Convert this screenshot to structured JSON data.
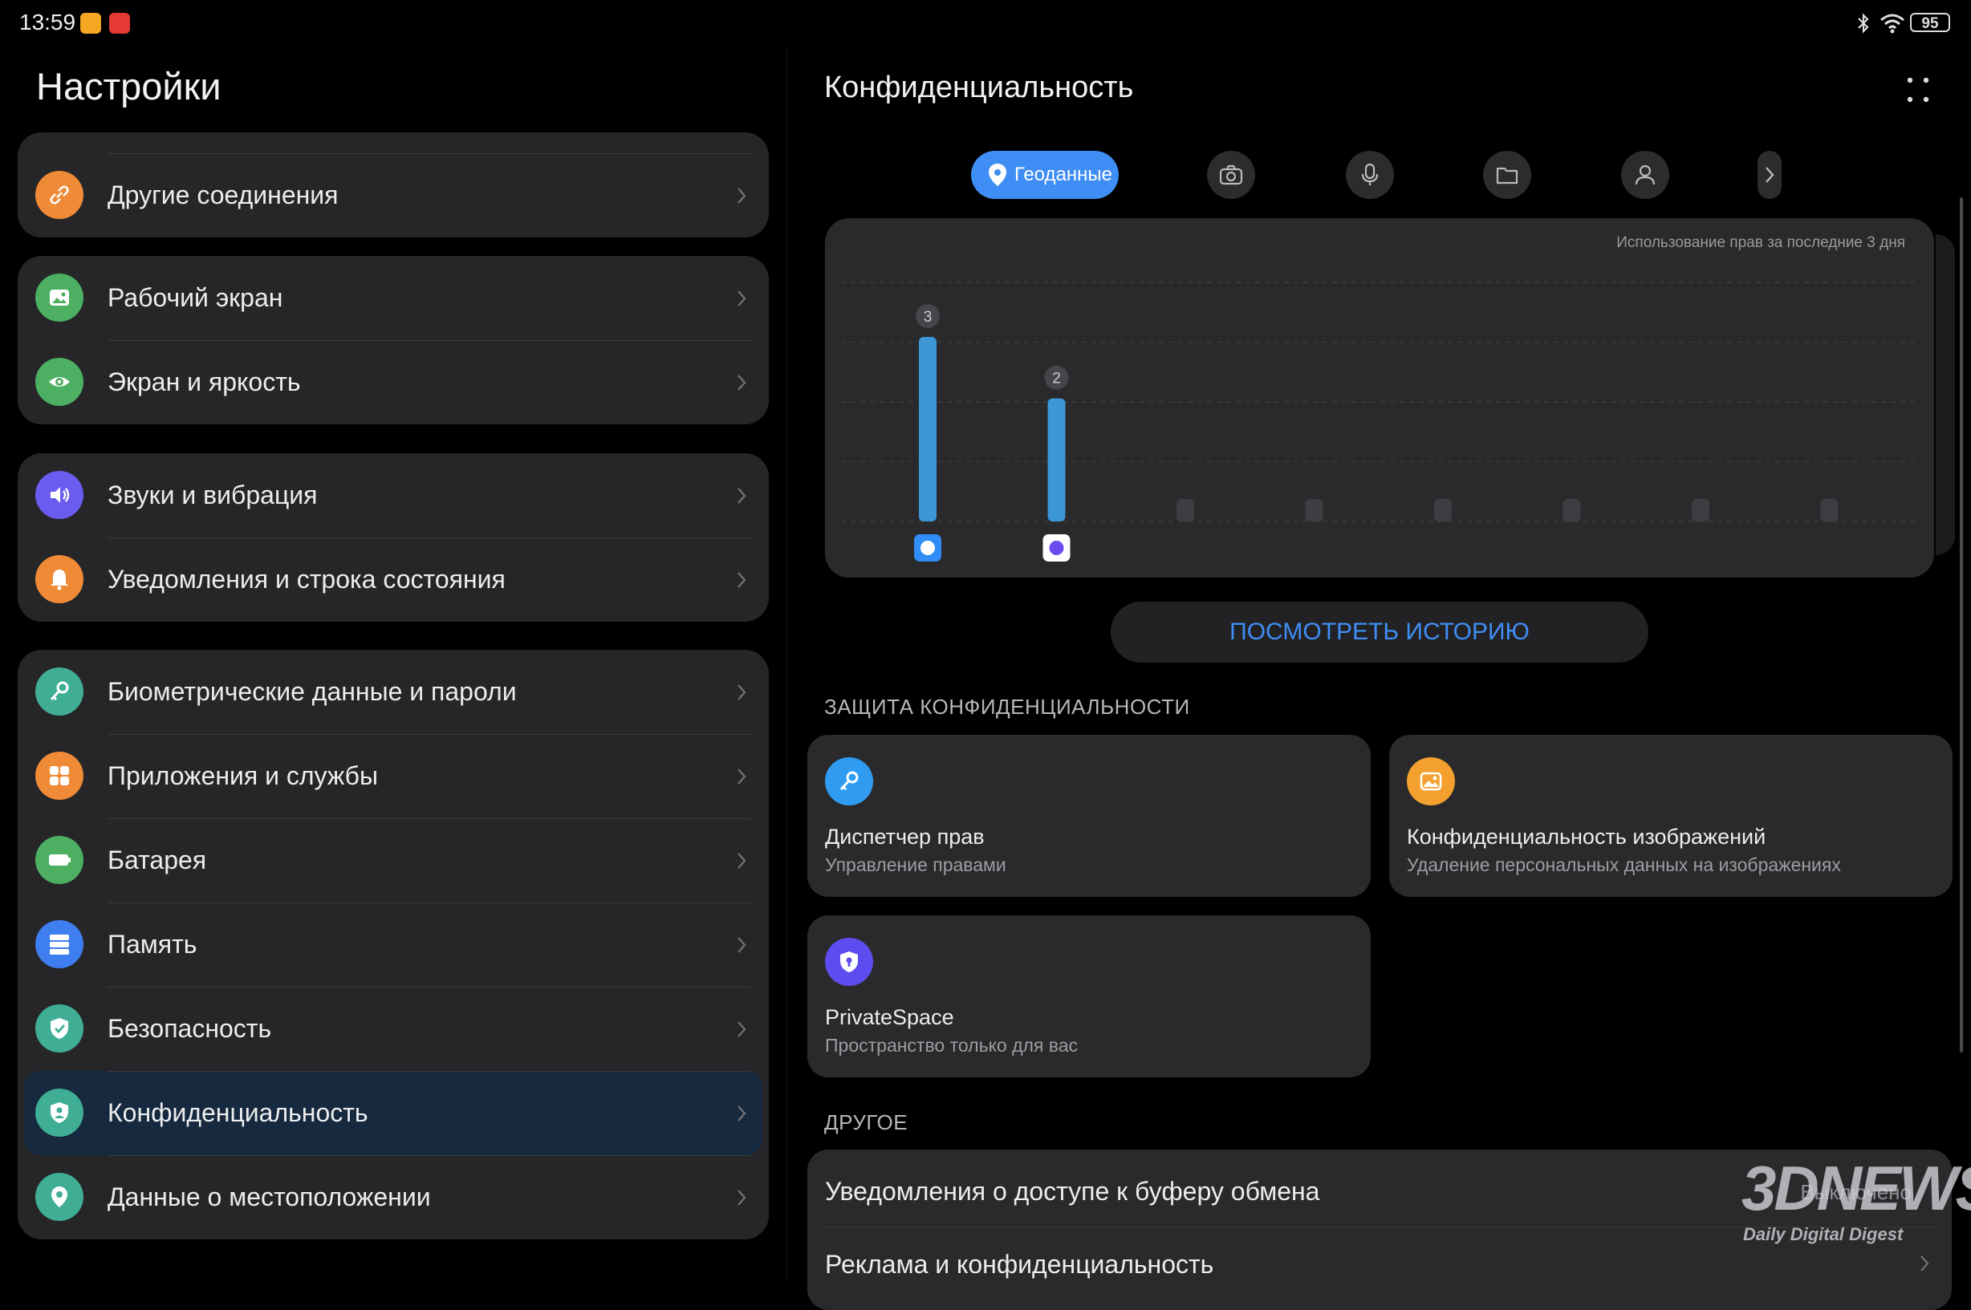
{
  "status_bar": {
    "time": "13:59",
    "battery": "95"
  },
  "settings": {
    "title": "Настройки",
    "groups": [
      {
        "items": [
          {
            "label": "Другие соединения",
            "icon": "link-icon",
            "color": "#ef8a36"
          }
        ]
      },
      {
        "items": [
          {
            "label": "Рабочий экран",
            "icon": "image-icon",
            "color": "#4caf62"
          },
          {
            "label": "Экран и яркость",
            "icon": "eye-icon",
            "color": "#4caf62"
          }
        ]
      },
      {
        "items": [
          {
            "label": "Звуки и вибрация",
            "icon": "speaker-icon",
            "color": "#6b5cf0"
          },
          {
            "label": "Уведомления и строка состояния",
            "icon": "bell-icon",
            "color": "#ef8a36"
          }
        ]
      },
      {
        "items": [
          {
            "label": "Биометрические данные и пароли",
            "icon": "key-icon",
            "color": "#3fae94"
          },
          {
            "label": "Приложения и службы",
            "icon": "apps-grid-icon",
            "color": "#ef8a36"
          },
          {
            "label": "Батарея",
            "icon": "battery-icon",
            "color": "#4caf62"
          },
          {
            "label": "Память",
            "icon": "storage-icon",
            "color": "#3f7ef0"
          },
          {
            "label": "Безопасность",
            "icon": "shield-check-icon",
            "color": "#3fae94"
          },
          {
            "label": "Конфиденциальность",
            "icon": "privacy-shield-icon",
            "color": "#3fae94",
            "selected": true
          },
          {
            "label": "Данные о местоположении",
            "icon": "location-pin-icon",
            "color": "#3fae94"
          }
        ]
      }
    ]
  },
  "privacy": {
    "title": "Конфиденциальность",
    "tabs": [
      {
        "label": "Геоданные",
        "icon": "location-pin-icon",
        "active": true
      },
      {
        "label": "",
        "icon": "camera-icon"
      },
      {
        "label": "",
        "icon": "microphone-icon"
      },
      {
        "label": "",
        "icon": "folder-icon"
      },
      {
        "label": "",
        "icon": "contacts-icon"
      },
      {
        "label": "",
        "icon": "chevron-right-icon"
      }
    ],
    "chart_caption": "Использование прав за последние 3 дня",
    "history_button": "ПОСМОТРЕТЬ ИСТОРИЮ",
    "protection_header": "ЗАЩИТА КОНФИДЕНЦИАЛЬНОСТИ",
    "cards": [
      {
        "title": "Диспетчер прав",
        "subtitle": "Управление правами",
        "icon": "key-icon",
        "color": "#2f9cf2"
      },
      {
        "title": "Конфиденциальность изображений",
        "subtitle": "Удаление персональных данных на изображениях",
        "icon": "photo-icon",
        "color": "#f3a02f"
      },
      {
        "title": "PrivateSpace",
        "subtitle": "Пространство только для вас",
        "icon": "shield-lock-icon",
        "color": "#5d4cf0"
      }
    ],
    "other_header": "ДРУГОЕ",
    "other_items": [
      {
        "label": "Уведомления о доступе к буферу обмена",
        "value": "Выключено"
      },
      {
        "label": "Реклама и конфиденциальность"
      }
    ]
  },
  "watermark": {
    "brand": "3DNEWS",
    "tagline": "Daily Digital Digest"
  },
  "colors": {
    "accent": "#3f8ef5",
    "bar": "#3d96d6",
    "selected_row": "#16293f"
  },
  "chart_data": {
    "type": "bar",
    "title": "",
    "categories": [
      "weather-app",
      "assistant-app",
      "",
      "",
      "",
      "",
      "",
      ""
    ],
    "values": [
      3,
      2,
      0,
      0,
      0,
      0,
      0,
      0
    ],
    "data_labels": [
      "3",
      "2",
      "",
      "",
      "",
      "",
      "",
      ""
    ],
    "ylim": [
      0,
      3
    ],
    "grid": true,
    "xlabel": "",
    "ylabel": ""
  }
}
